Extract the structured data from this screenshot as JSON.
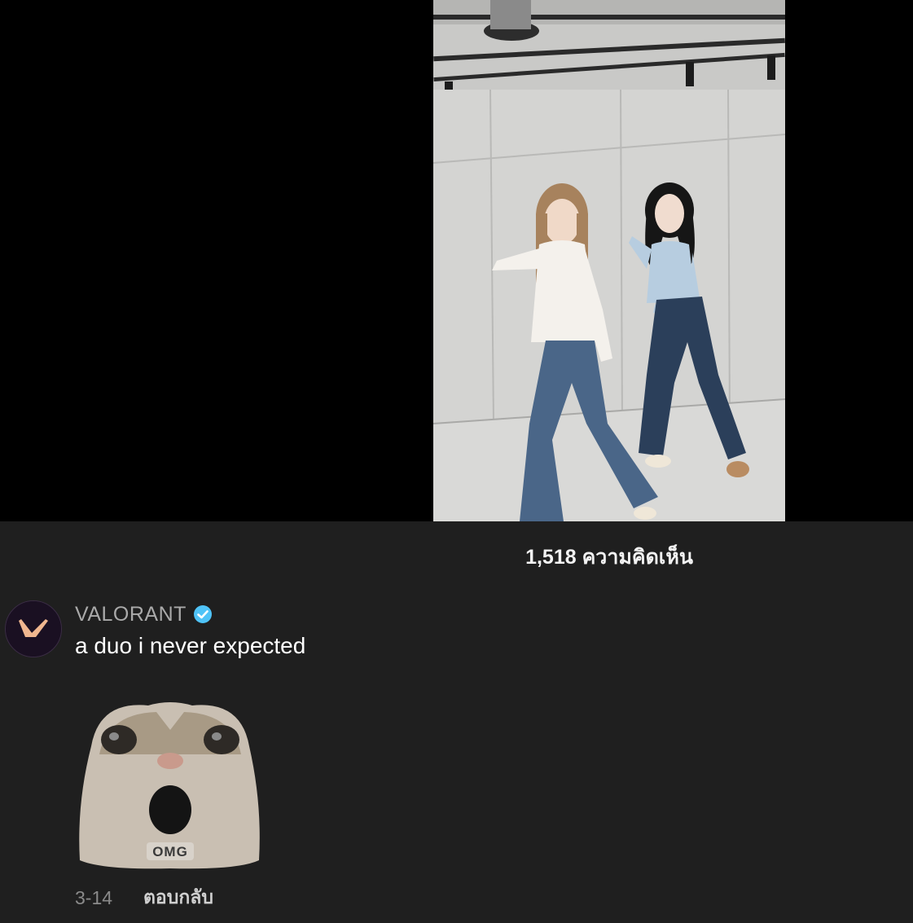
{
  "video": {
    "description_icon": "dance-video-thumbnail"
  },
  "comments_sheet": {
    "count_label": "1,518 ความคิดเห็น"
  },
  "comment": {
    "username": "VALORANT",
    "verified_icon": "verified-badge-icon",
    "text": "a duo i never expected",
    "sticker_label": "OMG",
    "date": "3-14",
    "reply_label": "ตอบกลับ"
  },
  "colors": {
    "background": "#1f1f1f",
    "verified": "#4fc3f7",
    "valorant_brand": "#f0b78f"
  }
}
